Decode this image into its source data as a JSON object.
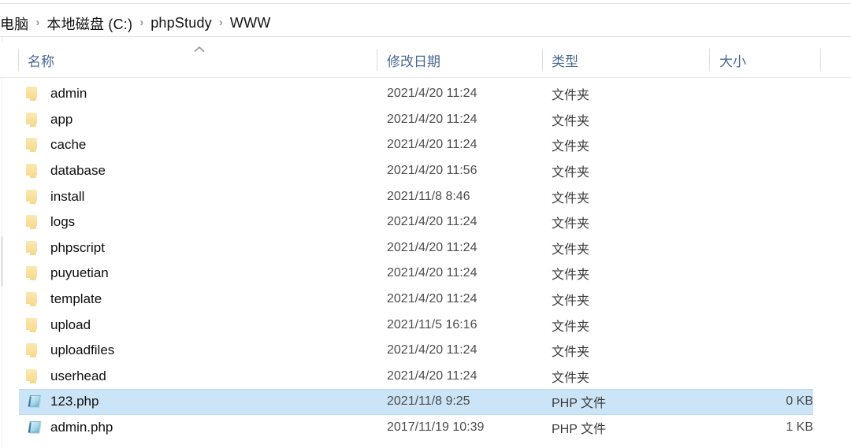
{
  "breadcrumb": {
    "separator": "›",
    "items": [
      "电脑",
      "本地磁盘 (C:)",
      "phpStudy",
      "WWW"
    ]
  },
  "columns": {
    "name": "名称",
    "modified": "修改日期",
    "type": "类型",
    "size": "大小",
    "sort_indicator": "ascending-chevron"
  },
  "colors": {
    "selection_fill": "#cce4f7",
    "selection_border": "#b8d9f2",
    "header_text": "#4a6a92",
    "folder_icon": "#f6d88a",
    "php_icon": "#6fb7d6"
  },
  "files": [
    {
      "name": "admin",
      "modified": "2021/4/20 11:24",
      "type": "文件夹",
      "size": "",
      "icon": "folder-icon",
      "selected": false
    },
    {
      "name": "app",
      "modified": "2021/4/20 11:24",
      "type": "文件夹",
      "size": "",
      "icon": "folder-icon",
      "selected": false
    },
    {
      "name": "cache",
      "modified": "2021/4/20 11:24",
      "type": "文件夹",
      "size": "",
      "icon": "folder-icon",
      "selected": false
    },
    {
      "name": "database",
      "modified": "2021/4/20 11:56",
      "type": "文件夹",
      "size": "",
      "icon": "folder-icon",
      "selected": false
    },
    {
      "name": "install",
      "modified": "2021/11/8 8:46",
      "type": "文件夹",
      "size": "",
      "icon": "folder-icon",
      "selected": false
    },
    {
      "name": "logs",
      "modified": "2021/4/20 11:24",
      "type": "文件夹",
      "size": "",
      "icon": "folder-icon",
      "selected": false
    },
    {
      "name": "phpscript",
      "modified": "2021/4/20 11:24",
      "type": "文件夹",
      "size": "",
      "icon": "folder-icon",
      "selected": false
    },
    {
      "name": "puyuetian",
      "modified": "2021/4/20 11:24",
      "type": "文件夹",
      "size": "",
      "icon": "folder-icon",
      "selected": false
    },
    {
      "name": "template",
      "modified": "2021/4/20 11:24",
      "type": "文件夹",
      "size": "",
      "icon": "folder-icon",
      "selected": false
    },
    {
      "name": "upload",
      "modified": "2021/11/5 16:16",
      "type": "文件夹",
      "size": "",
      "icon": "folder-icon",
      "selected": false
    },
    {
      "name": "uploadfiles",
      "modified": "2021/4/20 11:24",
      "type": "文件夹",
      "size": "",
      "icon": "folder-icon",
      "selected": false
    },
    {
      "name": "userhead",
      "modified": "2021/4/20 11:24",
      "type": "文件夹",
      "size": "",
      "icon": "folder-icon",
      "selected": false
    },
    {
      "name": "123.php",
      "modified": "2021/11/8 9:25",
      "type": "PHP 文件",
      "size": "0 KB",
      "icon": "php-file-icon",
      "selected": true
    },
    {
      "name": "admin.php",
      "modified": "2017/11/19 10:39",
      "type": "PHP 文件",
      "size": "1 KB",
      "icon": "php-file-icon",
      "selected": false
    }
  ]
}
